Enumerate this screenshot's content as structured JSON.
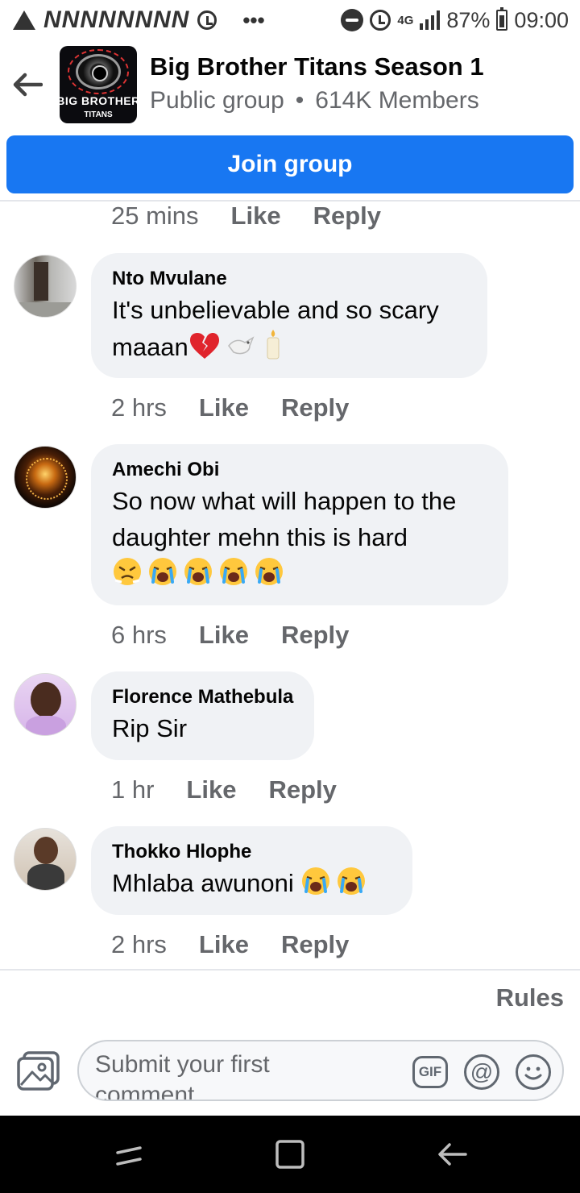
{
  "status_bar": {
    "notif_letters": "NNNNNNNN",
    "dots": "•••",
    "network": "4G",
    "battery": "87%",
    "time": "09:00"
  },
  "header": {
    "group_name": "Big Brother Titans Season 1",
    "privacy": "Public group",
    "separator": "•",
    "members": "614K Members",
    "logo_text": "BIG BROTHER",
    "logo_sub": "TITANS"
  },
  "join_label": "Join group",
  "prev_comment_actions": {
    "time": "25 mins",
    "like": "Like",
    "reply": "Reply"
  },
  "comments": [
    {
      "author": "Nto Mvulane",
      "text": "It's unbelievable and so scary maaan",
      "time": "2 hrs",
      "like": "Like",
      "reply": "Reply"
    },
    {
      "author": "Amechi Obi",
      "text": "So now what will happen to the daughter mehn this is hard",
      "time": "6 hrs",
      "like": "Like",
      "reply": "Reply"
    },
    {
      "author": "Florence Mathebula",
      "text": "Rip Sir",
      "time": "1 hr",
      "like": "Like",
      "reply": "Reply"
    },
    {
      "author": "Thokko Hlophe",
      "text": "Mhlaba awunoni",
      "time": "2 hrs",
      "like": "Like",
      "reply": "Reply"
    }
  ],
  "composer": {
    "rules_label": "Rules",
    "placeholder": "Submit your first comment",
    "gif_label": "GIF",
    "at_label": "@"
  },
  "colors": {
    "primary": "#1877f2",
    "bubble": "#f0f2f5",
    "secondary_text": "#65676b"
  }
}
